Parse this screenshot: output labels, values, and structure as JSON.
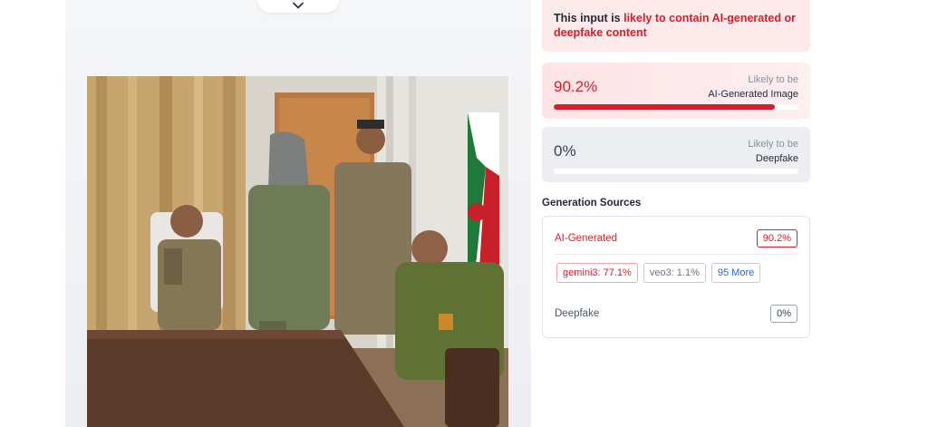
{
  "alert": {
    "prefix": "This input is ",
    "highlight": "likely to contain AI-generated or deepfake content"
  },
  "scores": {
    "ai": {
      "percent": "90.2%",
      "sub_label": "Likely to be",
      "main_label": "AI-Generated Image",
      "fraction": 0.902
    },
    "deepfake": {
      "percent": "0%",
      "sub_label": "Likely to be",
      "main_label": "Deepfake",
      "fraction": 0.0
    }
  },
  "sources": {
    "title": "Generation Sources",
    "ai": {
      "label": "AI-Generated",
      "value": "90.2%"
    },
    "chips": [
      {
        "text": "gemini3: 77.1%"
      },
      {
        "text": "veo3: 1.1%"
      },
      {
        "text": "95 More"
      }
    ],
    "deepfake": {
      "label": "Deepfake",
      "value": "0%"
    }
  },
  "icons": {
    "collapse": "chevron-down-icon"
  },
  "colors": {
    "accent_red": "#d61f2c",
    "link_blue": "#2563eb"
  }
}
